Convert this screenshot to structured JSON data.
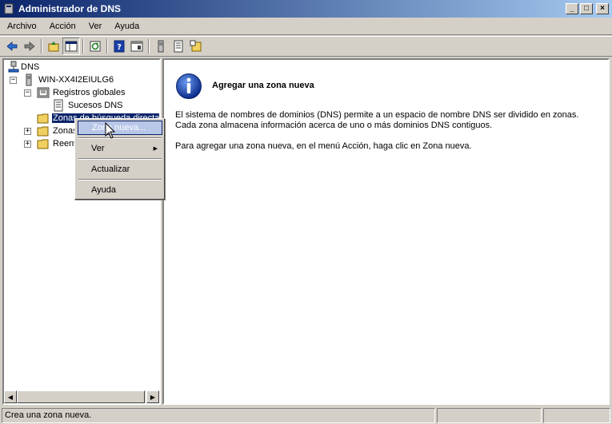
{
  "window": {
    "title": "Administrador de DNS",
    "minimize": "_",
    "maximize": "□",
    "close": "×"
  },
  "menu": [
    "Archivo",
    "Acción",
    "Ver",
    "Ayuda"
  ],
  "toolbar": [
    "back-icon",
    "forward-icon",
    "up-folder-icon",
    "show-hide-tree-icon",
    "refresh-icon",
    "help-icon",
    "properties-icon",
    "server-icon",
    "list-icon",
    "new-zone-icon"
  ],
  "tree": {
    "root": "DNS",
    "server": "WIN-XX4I2EIULG6",
    "global_logs": "Registros globales",
    "dns_events": "Sucesos DNS",
    "forward_zones": "Zonas de búsqueda directa",
    "reverse_zones": "Zonas de búsqueda inversa",
    "forwarders": "Reenviadores condicionales"
  },
  "context_menu": {
    "new_zone": "Zona nueva...",
    "view": "Ver",
    "refresh": "Actualizar",
    "help": "Ayuda"
  },
  "main": {
    "heading": "Agregar una zona nueva",
    "line1": "El sistema de nombres de dominios (DNS) permite a un espacio de nombre DNS ser dividido en zonas.",
    "line2": "Cada zona almacena información acerca de uno o más dominios DNS contiguos.",
    "line3": "Para agregar una zona nueva, en el menú Acción, haga clic en Zona nueva."
  },
  "status": {
    "text": "Crea una zona nueva."
  },
  "colors": {
    "title_start": "#0a246a",
    "title_end": "#a6caf0",
    "selection": "#0a246a",
    "face": "#d4d0c8"
  }
}
